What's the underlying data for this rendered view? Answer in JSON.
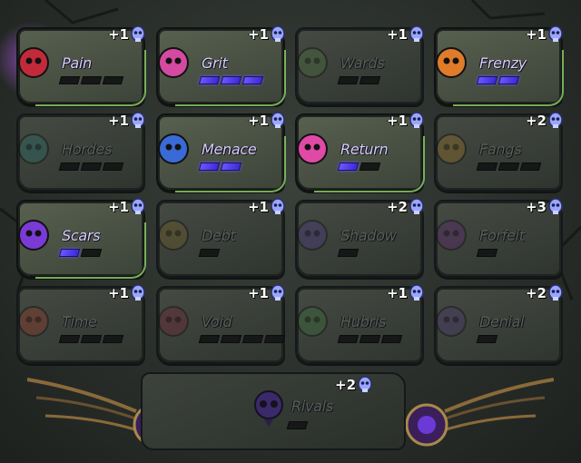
{
  "boons": [
    {
      "name": "Pain",
      "cost": "+1",
      "state": "active",
      "filled": 0,
      "bars": 3,
      "icon": "dagger-icon",
      "color": "#c22a3a"
    },
    {
      "name": "Grit",
      "cost": "+1",
      "state": "active",
      "filled": 3,
      "bars": 3,
      "icon": "heart-icon",
      "color": "#d44aa0"
    },
    {
      "name": "Wards",
      "cost": "+1",
      "state": "dim",
      "filled": 0,
      "bars": 2,
      "icon": "shield-face-icon",
      "color": "#4c6a3e"
    },
    {
      "name": "Frenzy",
      "cost": "+1",
      "state": "active",
      "filled": 2,
      "bars": 2,
      "icon": "flame-fist-icon",
      "color": "#e07b2a"
    },
    {
      "name": "Hordes",
      "cost": "+1",
      "state": "dim",
      "filled": 0,
      "bars": 3,
      "icon": "triple-orb-icon",
      "color": "#2d6a64"
    },
    {
      "name": "Menace",
      "cost": "+1",
      "state": "active",
      "filled": 2,
      "bars": 2,
      "icon": "blue-skull-flame-icon",
      "color": "#3a6ad6"
    },
    {
      "name": "Return",
      "cost": "+1",
      "state": "active",
      "filled": 1,
      "bars": 2,
      "icon": "pink-skull-icon",
      "color": "#e04aa6"
    },
    {
      "name": "Fangs",
      "cost": "+2",
      "state": "dim",
      "filled": 0,
      "bars": 3,
      "icon": "fangs-icon",
      "color": "#8a6a2a"
    },
    {
      "name": "Scars",
      "cost": "+1",
      "state": "active",
      "filled": 1,
      "bars": 2,
      "icon": "claw-marks-icon",
      "color": "#7a3ad6"
    },
    {
      "name": "Debt",
      "cost": "+1",
      "state": "dim",
      "filled": 0,
      "bars": 1,
      "icon": "coin-icon",
      "color": "#6a5a2a"
    },
    {
      "name": "Shadow",
      "cost": "+2",
      "state": "dim",
      "filled": 0,
      "bars": 1,
      "icon": "shadow-wisp-icon",
      "color": "#4a3a7a"
    },
    {
      "name": "Forfeit",
      "cost": "+3",
      "state": "dim",
      "filled": 0,
      "bars": 1,
      "icon": "bat-gem-icon",
      "color": "#5a2a6a"
    },
    {
      "name": "Time",
      "cost": "+1",
      "state": "dim",
      "filled": 0,
      "bars": 3,
      "icon": "hourglass-icon",
      "color": "#8a3a2a"
    },
    {
      "name": "Void",
      "cost": "+1",
      "state": "dim",
      "filled": 0,
      "bars": 4,
      "icon": "void-orb-icon",
      "color": "#6a2a3a"
    },
    {
      "name": "Hubris",
      "cost": "+1",
      "state": "dim",
      "filled": 0,
      "bars": 3,
      "icon": "leaf-skull-icon",
      "color": "#3a6a3a"
    },
    {
      "name": "Denial",
      "cost": "+2",
      "state": "dim",
      "filled": 0,
      "bars": 1,
      "icon": "flask-icon",
      "color": "#4a3a6a"
    }
  ],
  "rivals": {
    "name": "Rivals",
    "cost": "+2",
    "filled": 0,
    "bars": 1,
    "icon": "dark-skull-icon",
    "color": "#3a2a6a"
  },
  "colors": {
    "accent": "#6b57ff",
    "gem": "#c9d2ff",
    "active_edge": "#8fd36a"
  }
}
